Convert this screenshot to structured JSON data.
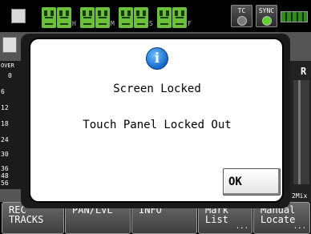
{
  "status_bar": {
    "counter_units": [
      "H",
      "M",
      "S",
      "F"
    ],
    "tc_label": "TC",
    "sync_label": "SYNC"
  },
  "meter_scale": {
    "label": "OVER",
    "ticks": [
      "0",
      "6",
      "12",
      "18",
      "24",
      "30",
      "36",
      "48",
      "56"
    ]
  },
  "right_panel": {
    "label": "R",
    "mix_label": "2Mix"
  },
  "bottom_buttons": [
    {
      "lines": [
        "REC",
        "TRACKS"
      ],
      "ellipsis": ""
    },
    {
      "lines": [
        "PAN/LVL"
      ],
      "ellipsis": ""
    },
    {
      "lines": [
        "INFO"
      ],
      "ellipsis": ""
    },
    {
      "lines": [
        "Mark",
        "List"
      ],
      "ellipsis": "..."
    },
    {
      "lines": [
        "Manual",
        "Locate"
      ],
      "ellipsis": "..."
    }
  ],
  "dialog": {
    "title": "Screen Locked",
    "message": "Touch Panel Locked Out",
    "ok_label": "OK"
  },
  "colors": {
    "counter_digits": "#6bc13a",
    "sync_led": "#5cd12c",
    "info_icon": "#1367c9"
  }
}
